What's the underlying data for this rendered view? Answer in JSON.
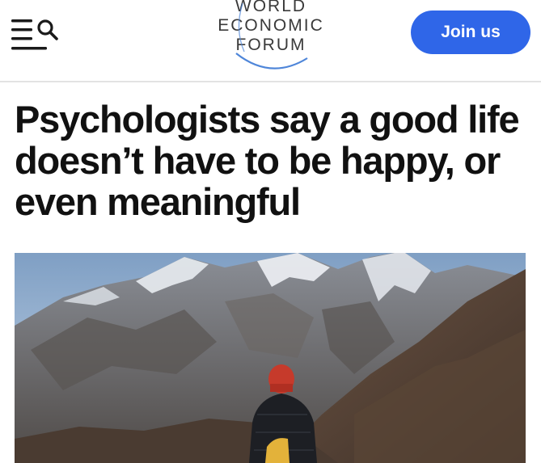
{
  "header": {
    "menu_icon": "hamburger-menu-icon",
    "search_icon": "search-icon",
    "logo": {
      "line1": "WORLD",
      "line2": "ECONOMIC",
      "line3": "FORUM"
    },
    "join_label": "Join us"
  },
  "article": {
    "headline": "Psychologists say a good life doesn’t have to be happy, or even meaningful",
    "hero_image_description_icon": "mountain-hiker-image"
  },
  "colors": {
    "accent": "#2f66e8",
    "headline_text": "#111111",
    "logo_text": "#3a3a3a",
    "logo_swoosh": "#4f86d9",
    "divider": "#e3e3e3"
  }
}
